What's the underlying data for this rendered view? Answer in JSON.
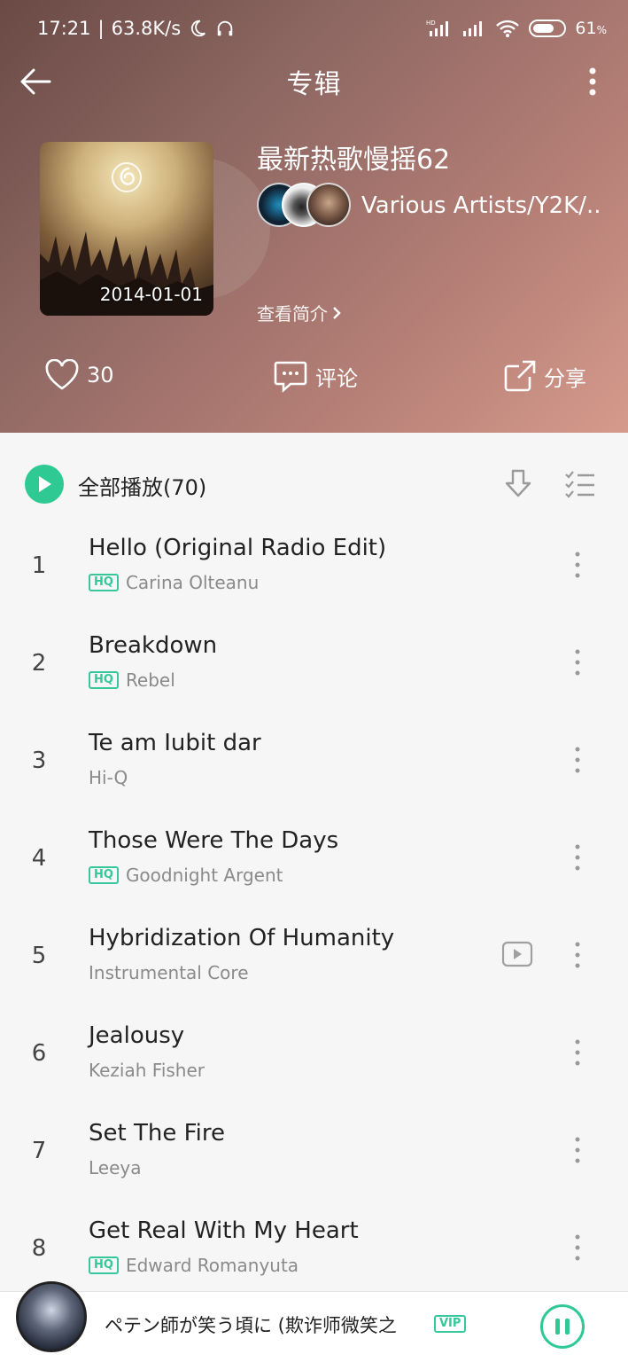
{
  "status_bar": {
    "time": "17:21",
    "speed": "63.8K/s",
    "battery": "61",
    "battery_unit": "%",
    "hd_label": "HD"
  },
  "topbar": {
    "title": "专辑"
  },
  "album": {
    "title": "最新热歌慢摇62",
    "date": "2014-01-01",
    "artists": "Various Artists/Y2K/...",
    "intro_link": "查看简介"
  },
  "actions": {
    "like_count": "30",
    "comment_label": "评论",
    "share_label": "分享"
  },
  "play_all": {
    "label": "全部播放(70)"
  },
  "tracks": [
    {
      "num": "1",
      "title": "Hello (Original Radio Edit)",
      "artist": "Carina Olteanu",
      "hq": "HQ"
    },
    {
      "num": "2",
      "title": "Breakdown",
      "artist": "Rebel",
      "hq": "HQ"
    },
    {
      "num": "3",
      "title": "Te am Iubit dar",
      "artist": "Hi-Q"
    },
    {
      "num": "4",
      "title": "Those Were The Days",
      "artist": "Goodnight Argent",
      "hq": "HQ"
    },
    {
      "num": "5",
      "title": "Hybridization Of Humanity",
      "artist": "Instrumental Core"
    },
    {
      "num": "6",
      "title": "Jealousy",
      "artist": "Keziah Fisher"
    },
    {
      "num": "7",
      "title": "Set The Fire",
      "artist": "Leeya"
    },
    {
      "num": "8",
      "title": "Get Real With My Heart",
      "artist": "Edward Romanyuta",
      "hq": "HQ"
    }
  ],
  "mini_player": {
    "title": "ペテン師が笑う頃に (欺诈师微笑之",
    "vip": "VIP"
  },
  "colors": {
    "accent": "#2fc993",
    "header_start": "#6a4a46",
    "header_end": "#d59a8c"
  }
}
